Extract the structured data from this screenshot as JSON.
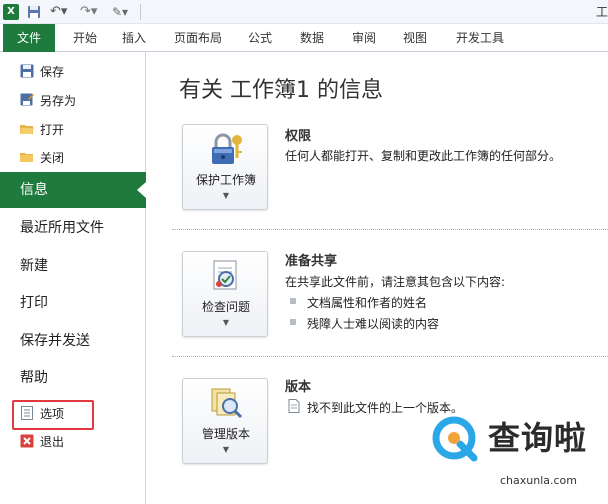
{
  "window": {
    "title_fragment": "工"
  },
  "qat": {
    "app_logo": "X"
  },
  "tabs": [
    "文件",
    "开始",
    "插入",
    "页面布局",
    "公式",
    "数据",
    "审阅",
    "视图",
    "开发工具"
  ],
  "backstage": {
    "commands": [
      {
        "label": "保存",
        "icon": "save-icon"
      },
      {
        "label": "另存为",
        "icon": "save-as-icon"
      },
      {
        "label": "打开",
        "icon": "open-folder-icon"
      },
      {
        "label": "关闭",
        "icon": "close-folder-icon"
      }
    ],
    "nav": [
      "信息",
      "最近所用文件",
      "新建",
      "打印",
      "保存并发送",
      "帮助"
    ],
    "bottom_commands": [
      {
        "label": "选项",
        "icon": "options-icon"
      },
      {
        "label": "退出",
        "icon": "exit-icon"
      }
    ]
  },
  "content": {
    "title": "有关 工作簿1 的信息",
    "permissions": {
      "button": "保护工作簿",
      "heading": "权限",
      "description": "任何人都能打开、复制和更改此工作簿的任何部分。"
    },
    "prepare": {
      "button": "检查问题",
      "heading": "准备共享",
      "description": "在共享此文件前，请注意其包含以下内容:",
      "items": [
        "文档属性和作者的姓名",
        "残障人士难以阅读的内容"
      ]
    },
    "versions": {
      "button": "管理版本",
      "heading": "版本",
      "description": "找不到此文件的上一个版本。"
    }
  },
  "watermark": {
    "text": "查询啦",
    "url": "chaxunla.com"
  },
  "colors": {
    "accent": "#1f7a3d",
    "highlight": "#e0393e"
  }
}
